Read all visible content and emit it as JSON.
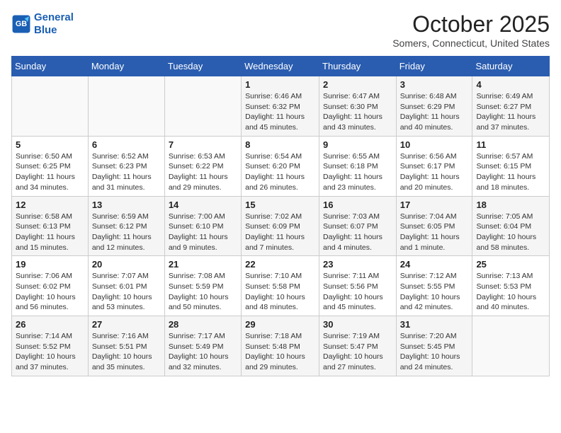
{
  "header": {
    "logo_line1": "General",
    "logo_line2": "Blue",
    "month": "October 2025",
    "location": "Somers, Connecticut, United States"
  },
  "weekdays": [
    "Sunday",
    "Monday",
    "Tuesday",
    "Wednesday",
    "Thursday",
    "Friday",
    "Saturday"
  ],
  "weeks": [
    [
      {
        "day": "",
        "content": ""
      },
      {
        "day": "",
        "content": ""
      },
      {
        "day": "",
        "content": ""
      },
      {
        "day": "1",
        "content": "Sunrise: 6:46 AM\nSunset: 6:32 PM\nDaylight: 11 hours and 45 minutes."
      },
      {
        "day": "2",
        "content": "Sunrise: 6:47 AM\nSunset: 6:30 PM\nDaylight: 11 hours and 43 minutes."
      },
      {
        "day": "3",
        "content": "Sunrise: 6:48 AM\nSunset: 6:29 PM\nDaylight: 11 hours and 40 minutes."
      },
      {
        "day": "4",
        "content": "Sunrise: 6:49 AM\nSunset: 6:27 PM\nDaylight: 11 hours and 37 minutes."
      }
    ],
    [
      {
        "day": "5",
        "content": "Sunrise: 6:50 AM\nSunset: 6:25 PM\nDaylight: 11 hours and 34 minutes."
      },
      {
        "day": "6",
        "content": "Sunrise: 6:52 AM\nSunset: 6:23 PM\nDaylight: 11 hours and 31 minutes."
      },
      {
        "day": "7",
        "content": "Sunrise: 6:53 AM\nSunset: 6:22 PM\nDaylight: 11 hours and 29 minutes."
      },
      {
        "day": "8",
        "content": "Sunrise: 6:54 AM\nSunset: 6:20 PM\nDaylight: 11 hours and 26 minutes."
      },
      {
        "day": "9",
        "content": "Sunrise: 6:55 AM\nSunset: 6:18 PM\nDaylight: 11 hours and 23 minutes."
      },
      {
        "day": "10",
        "content": "Sunrise: 6:56 AM\nSunset: 6:17 PM\nDaylight: 11 hours and 20 minutes."
      },
      {
        "day": "11",
        "content": "Sunrise: 6:57 AM\nSunset: 6:15 PM\nDaylight: 11 hours and 18 minutes."
      }
    ],
    [
      {
        "day": "12",
        "content": "Sunrise: 6:58 AM\nSunset: 6:13 PM\nDaylight: 11 hours and 15 minutes."
      },
      {
        "day": "13",
        "content": "Sunrise: 6:59 AM\nSunset: 6:12 PM\nDaylight: 11 hours and 12 minutes."
      },
      {
        "day": "14",
        "content": "Sunrise: 7:00 AM\nSunset: 6:10 PM\nDaylight: 11 hours and 9 minutes."
      },
      {
        "day": "15",
        "content": "Sunrise: 7:02 AM\nSunset: 6:09 PM\nDaylight: 11 hours and 7 minutes."
      },
      {
        "day": "16",
        "content": "Sunrise: 7:03 AM\nSunset: 6:07 PM\nDaylight: 11 hours and 4 minutes."
      },
      {
        "day": "17",
        "content": "Sunrise: 7:04 AM\nSunset: 6:05 PM\nDaylight: 11 hours and 1 minute."
      },
      {
        "day": "18",
        "content": "Sunrise: 7:05 AM\nSunset: 6:04 PM\nDaylight: 10 hours and 58 minutes."
      }
    ],
    [
      {
        "day": "19",
        "content": "Sunrise: 7:06 AM\nSunset: 6:02 PM\nDaylight: 10 hours and 56 minutes."
      },
      {
        "day": "20",
        "content": "Sunrise: 7:07 AM\nSunset: 6:01 PM\nDaylight: 10 hours and 53 minutes."
      },
      {
        "day": "21",
        "content": "Sunrise: 7:08 AM\nSunset: 5:59 PM\nDaylight: 10 hours and 50 minutes."
      },
      {
        "day": "22",
        "content": "Sunrise: 7:10 AM\nSunset: 5:58 PM\nDaylight: 10 hours and 48 minutes."
      },
      {
        "day": "23",
        "content": "Sunrise: 7:11 AM\nSunset: 5:56 PM\nDaylight: 10 hours and 45 minutes."
      },
      {
        "day": "24",
        "content": "Sunrise: 7:12 AM\nSunset: 5:55 PM\nDaylight: 10 hours and 42 minutes."
      },
      {
        "day": "25",
        "content": "Sunrise: 7:13 AM\nSunset: 5:53 PM\nDaylight: 10 hours and 40 minutes."
      }
    ],
    [
      {
        "day": "26",
        "content": "Sunrise: 7:14 AM\nSunset: 5:52 PM\nDaylight: 10 hours and 37 minutes."
      },
      {
        "day": "27",
        "content": "Sunrise: 7:16 AM\nSunset: 5:51 PM\nDaylight: 10 hours and 35 minutes."
      },
      {
        "day": "28",
        "content": "Sunrise: 7:17 AM\nSunset: 5:49 PM\nDaylight: 10 hours and 32 minutes."
      },
      {
        "day": "29",
        "content": "Sunrise: 7:18 AM\nSunset: 5:48 PM\nDaylight: 10 hours and 29 minutes."
      },
      {
        "day": "30",
        "content": "Sunrise: 7:19 AM\nSunset: 5:47 PM\nDaylight: 10 hours and 27 minutes."
      },
      {
        "day": "31",
        "content": "Sunrise: 7:20 AM\nSunset: 5:45 PM\nDaylight: 10 hours and 24 minutes."
      },
      {
        "day": "",
        "content": ""
      }
    ]
  ]
}
